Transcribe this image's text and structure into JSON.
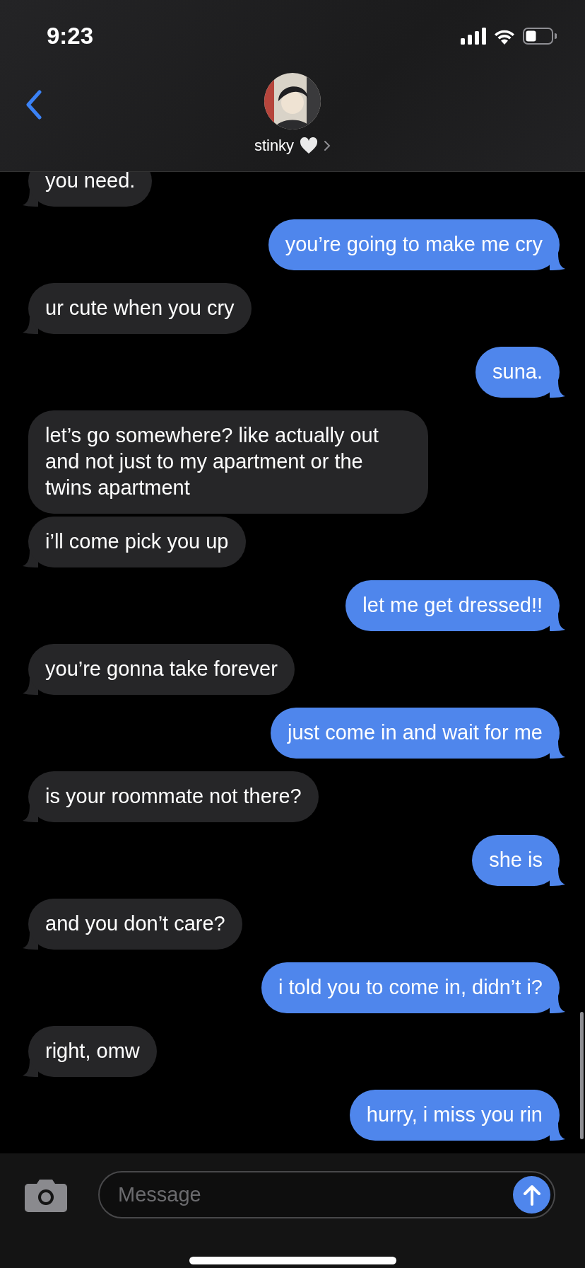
{
  "status_bar": {
    "time": "9:23"
  },
  "header": {
    "contact_name": "stinky"
  },
  "messages": [
    {
      "kind": "received",
      "text": "you need.",
      "tail": true
    },
    {
      "kind": "sent",
      "text": "you’re going to make me cry",
      "tail": true
    },
    {
      "kind": "received",
      "text": "ur cute when you cry",
      "tail": true
    },
    {
      "kind": "sent",
      "text": "suna.",
      "tail": true
    },
    {
      "kind": "received",
      "text": "let’s go somewhere? like actually out and not just to my apartment or the twins apartment",
      "tail": false
    },
    {
      "kind": "received",
      "text": "i’ll come pick you up",
      "tail": true
    },
    {
      "kind": "sent",
      "text": "let me get dressed!!",
      "tail": true
    },
    {
      "kind": "received",
      "text": "you’re gonna take forever",
      "tail": true
    },
    {
      "kind": "sent",
      "text": "just come in and wait for me",
      "tail": true
    },
    {
      "kind": "received",
      "text": "is your roommate not there?",
      "tail": true
    },
    {
      "kind": "sent",
      "text": "she is",
      "tail": true
    },
    {
      "kind": "received",
      "text": "and you don’t care?",
      "tail": true
    },
    {
      "kind": "sent",
      "text": "i told you to come in, didn’t i?",
      "tail": true
    },
    {
      "kind": "received",
      "text": "right, omw",
      "tail": true
    },
    {
      "kind": "sent",
      "text": "hurry, i miss you rin",
      "tail": true
    }
  ],
  "composer": {
    "placeholder": "Message"
  }
}
